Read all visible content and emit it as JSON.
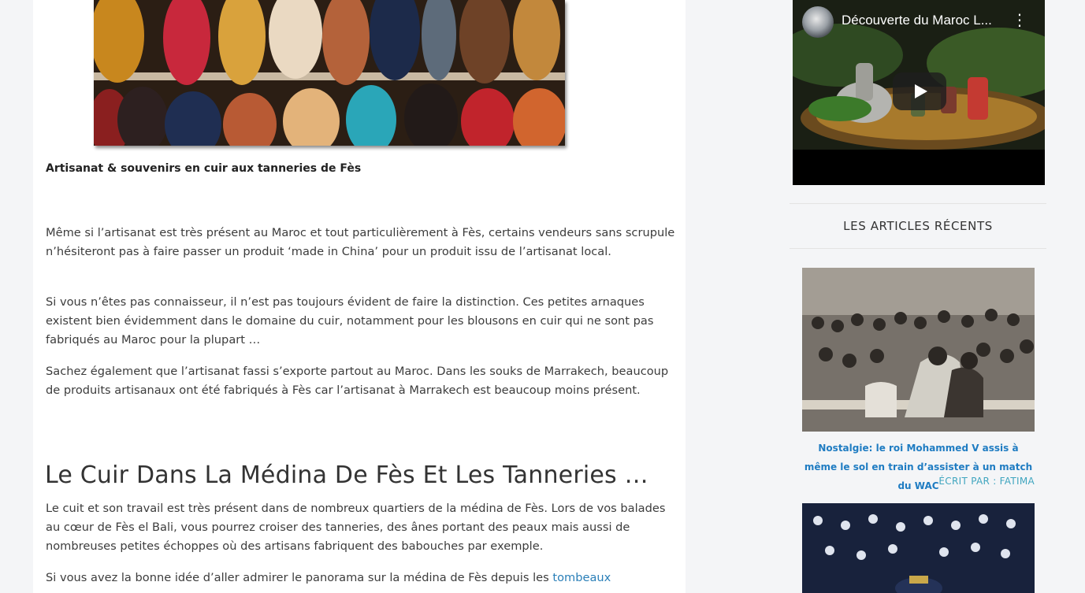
{
  "article": {
    "image_caption": "Artisanat & souvenirs en cuir aux tanneries de Fès",
    "paragraphs": [
      "Même si l’artisanat est très présent au Maroc et tout particulièrement à Fès, certains vendeurs sans scrupule n’hésiteront pas à faire passer un produit ‘made in China’ pour un produit issu de l’artisanat local.",
      "Si vous n’êtes pas connaisseur, il n’est pas toujours évident de faire la distinction. Ces petites arnaques existent bien évidemment dans le domaine du cuir, notamment pour les blousons en cuir qui ne sont pas fabriqués au Maroc pour la plupart …",
      "Sachez également que l’artisanat fassi s’exporte partout au Maroc. Dans les souks de Marrakech, beaucoup de produits artisanaux ont été fabriqués à Fès car l’artisanat à Marrakech est beaucoup moins présent."
    ],
    "section_heading": "Le Cuir Dans La Médina De Fès Et Les Tanneries …",
    "section_paragraph": "Le cuit et son travail est très présent dans de nombreux quartiers de la médina de Fès. Lors de vos balades au cœur de Fès el Bali, vous pourrez croiser des tanneries, des ânes portant des peaux mais aussi de nombreuses petites échoppes où des artisans fabriquent des babouches par exemple.",
    "last_paragraph_start": "Si vous avez la bonne idée d’aller admirer le panorama sur la médina de Fès depuis les ",
    "last_paragraph_link": "tombeaux"
  },
  "sidebar": {
    "video": {
      "title": "Découverte du Maroc L...",
      "menu_icon": "more-vert-icon",
      "play_icon": "play-icon"
    },
    "recent_title": "LES ARTICLES RÉCENTS",
    "articles": [
      {
        "title": "Nostalgie: le roi Mohammed V assis à même le sol en train d’assister à un match du WAC",
        "author": "ÉCRIT PAR : FATIMA"
      }
    ]
  },
  "colors": {
    "link": "#1f7cc2",
    "author": "#3fa5bf",
    "text": "#3c3c3c"
  }
}
